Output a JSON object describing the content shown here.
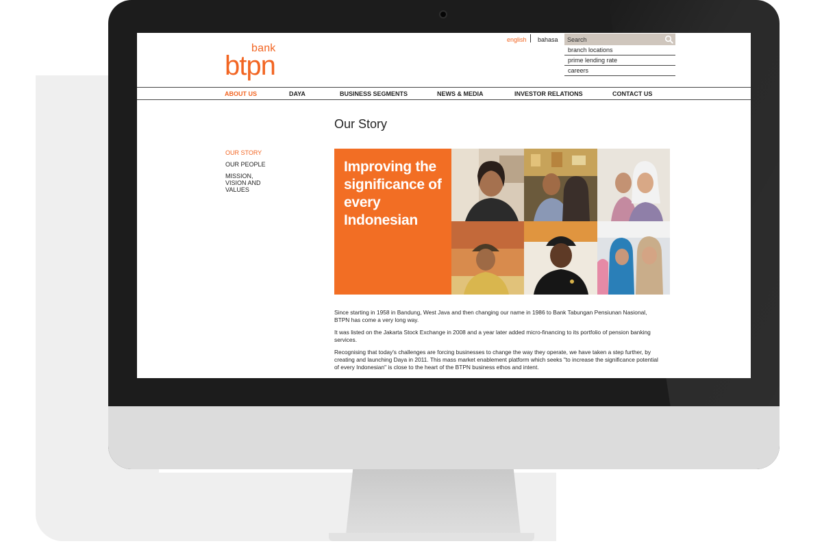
{
  "header": {
    "logo_bank": "bank",
    "logo_btpn": "btpn",
    "lang_english": "english",
    "lang_bahasa": "bahasa",
    "search_placeholder": "Search",
    "quick_links": [
      "branch locations",
      "prime lending rate",
      "careers"
    ]
  },
  "nav": {
    "items": [
      "ABOUT US",
      "DAYA",
      "BUSINESS SEGMENTS",
      "NEWS & MEDIA",
      "INVESTOR RELATIONS",
      "CONTACT US"
    ],
    "active": "ABOUT US"
  },
  "page": {
    "title": "Our Story",
    "side_nav": [
      "OUR STORY",
      "OUR PEOPLE",
      "MISSION, VISION AND VALUES"
    ],
    "hero_text": "Improving the significance of every Indonesian",
    "paragraphs": [
      "Since starting in 1958 in Bandung, West Java and then changing our name in 1986 to Bank Tabungan Pensiunan Nasional, BTPN has come a very long way.",
      "It was listed on the Jakarta Stock Exchange in 2008 and a year later added micro-financing to its portfolio of pension banking services.",
      "Recognising that today's challenges are forcing businesses to change the way they operate, we have taken a step further, by creating and launching Daya in 2011. This mass market enablement platform which seeks \"to increase the significance potential of every Indonesian\" is close to the heart of the BTPN business ethos and intent."
    ]
  },
  "colors": {
    "brand_orange": "#f26522",
    "monitor_bezel": "#1c1c1c",
    "search_bg": "#cfc6bd"
  },
  "icons": {
    "search": "search-icon",
    "camera": "camera-icon"
  }
}
